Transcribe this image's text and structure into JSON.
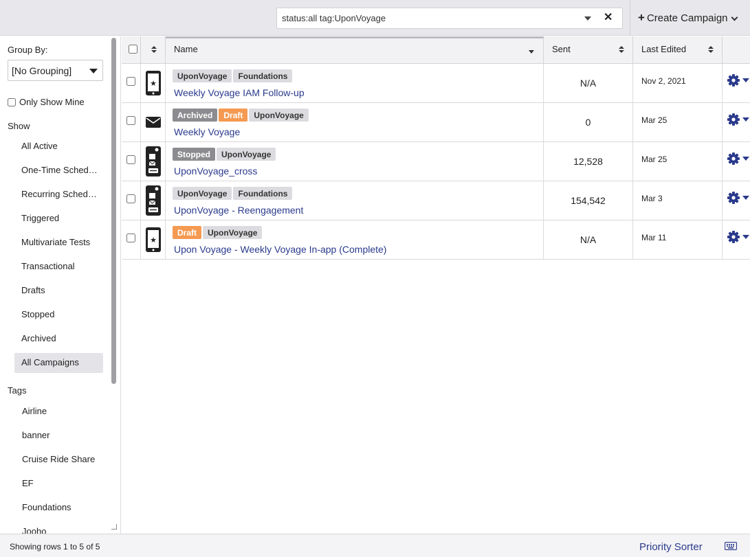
{
  "search": {
    "value": "status:all tag:UponVoyage",
    "clear_icon": "✕"
  },
  "toolbar": {
    "create_label": "Create Campaign"
  },
  "sidebar": {
    "group_by_label": "Group By:",
    "group_by_value": "[No Grouping]",
    "only_show_mine": "Only Show Mine",
    "show_label": "Show",
    "show_items": [
      {
        "label": "All Active"
      },
      {
        "label": "One-Time Sched…"
      },
      {
        "label": "Recurring Sched…"
      },
      {
        "label": "Triggered"
      },
      {
        "label": "Multivariate Tests"
      },
      {
        "label": "Transactional"
      },
      {
        "label": "Drafts"
      },
      {
        "label": "Stopped"
      },
      {
        "label": "Archived"
      },
      {
        "label": "All Campaigns"
      }
    ],
    "active_item": "All Campaigns",
    "tags_label": "Tags",
    "tags": [
      "Airline",
      "banner",
      "Cruise Ride Share",
      "EF",
      "Foundations",
      "Jooho"
    ]
  },
  "table": {
    "columns": {
      "name": "Name",
      "sent": "Sent",
      "last_edited": "Last Edited"
    },
    "rows": [
      {
        "icon": "mobile-iam-icon",
        "tags": [
          {
            "label": "UponVoyage",
            "style": "grey"
          },
          {
            "label": "Foundations",
            "style": "grey"
          }
        ],
        "name": "Weekly Voyage IAM Follow-up",
        "sent": "N/A",
        "last_edited": "Nov 2, 2021"
      },
      {
        "icon": "email-icon",
        "tags": [
          {
            "label": "Archived",
            "style": "dark"
          },
          {
            "label": "Draft",
            "style": "orange"
          },
          {
            "label": "UponVoyage",
            "style": "grey"
          }
        ],
        "name": "Weekly Voyage",
        "sent": "0",
        "last_edited": "Mar 25"
      },
      {
        "icon": "multichannel-icon",
        "tags": [
          {
            "label": "Stopped",
            "style": "dark"
          },
          {
            "label": "UponVoyage",
            "style": "grey"
          }
        ],
        "name": "UponVoyage_cross",
        "sent": "12,528",
        "last_edited": "Mar 25"
      },
      {
        "icon": "multichannel-icon",
        "tags": [
          {
            "label": "UponVoyage",
            "style": "grey"
          },
          {
            "label": "Foundations",
            "style": "grey"
          }
        ],
        "name": "UponVoyage - Reengagement",
        "sent": "154,542",
        "last_edited": "Mar 3"
      },
      {
        "icon": "mobile-iam-icon",
        "tags": [
          {
            "label": "Draft",
            "style": "orange"
          },
          {
            "label": "UponVoyage",
            "style": "grey"
          }
        ],
        "name": "Upon Voyage - Weekly Voyage In-app (Complete)",
        "sent": "N/A",
        "last_edited": "Mar 11"
      }
    ]
  },
  "footer": {
    "rows_text": "Showing rows 1 to 5 of 5",
    "priority_sorter": "Priority Sorter"
  },
  "colors": {
    "link": "#2a3a8c",
    "orange_tag": "#f59a52",
    "dark_tag": "#8c8c90",
    "grey_tag": "#dcdce0"
  }
}
